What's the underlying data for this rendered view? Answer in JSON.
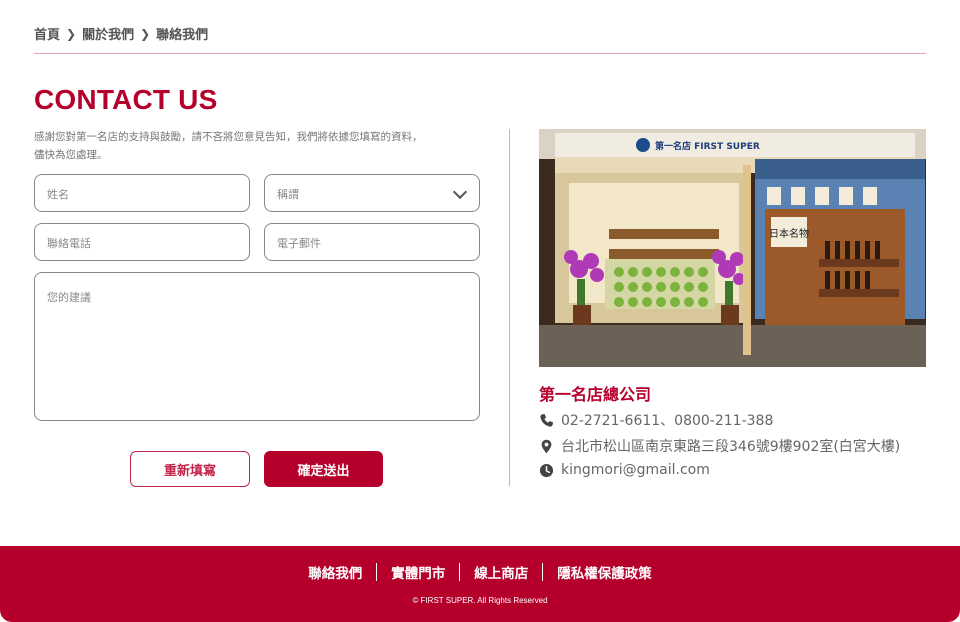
{
  "breadcrumb": {
    "home": "首頁",
    "about": "關於我們",
    "current": "聯絡我們"
  },
  "page": {
    "title": "CONTACT US",
    "intro_line1": "感謝您對第一名店的支持與鼓勵，請不吝將您意見告知，我們將依據您填寫的資料，",
    "intro_line2": "儘快為您處理。"
  },
  "form": {
    "name_placeholder": "姓名",
    "title_placeholder": "稱謂",
    "phone_placeholder": "聯絡電話",
    "email_placeholder": "電子郵件",
    "message_placeholder": "您的建議",
    "reset_label": "重新填寫",
    "submit_label": "確定送出"
  },
  "store": {
    "company_name": "第一名店總公司",
    "phone": "02-2721-6611、0800-211-388",
    "address": "台北市松山區南京東路三段346號9樓902室(白宮大樓)",
    "email": "kingmori@gmail.com",
    "sign_text": "第一名店  FIRST SUPER",
    "shelf_sign": "日本名物"
  },
  "footer": {
    "links": [
      "聯絡我們",
      "實體門市",
      "線上商店",
      "隱私權保護政策"
    ],
    "copyright": "© FIRST SUPER. All Rights Reserved"
  },
  "colors": {
    "brand": "#b5002c",
    "divider": "#e6a3b0"
  }
}
